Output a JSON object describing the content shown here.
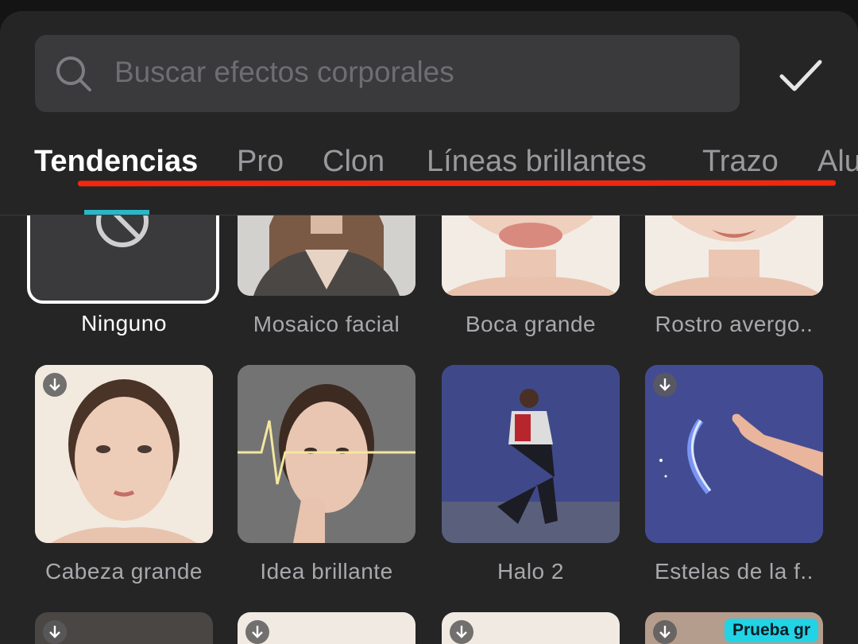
{
  "search": {
    "placeholder": "Buscar efectos corporales"
  },
  "tabs": [
    {
      "label": "Tendencias",
      "active": true
    },
    {
      "label": "Pro"
    },
    {
      "label": "Clon"
    },
    {
      "label": "Líneas brillantes"
    },
    {
      "label": "Trazo"
    },
    {
      "label": "Alu"
    }
  ],
  "effects_row1": [
    {
      "label": "Ninguno",
      "selected": true
    },
    {
      "label": "Mosaico facial"
    },
    {
      "label": "Boca grande"
    },
    {
      "label": "Rostro avergo.."
    }
  ],
  "effects_row2": [
    {
      "label": "Cabeza grande"
    },
    {
      "label": "Idea brillante"
    },
    {
      "label": "Halo 2"
    },
    {
      "label": "Estelas de la f.."
    }
  ],
  "effects_row3": [
    {
      "label": ""
    },
    {
      "label": ""
    },
    {
      "label": ""
    },
    {
      "label": "",
      "badge": "Prueba gr"
    }
  ],
  "colors": {
    "accent_underline": "#f0280f",
    "selected_indicator": "#2bb6c8",
    "promo_badge": "#22d3e6"
  },
  "icons": [
    "search-icon",
    "checkmark-icon",
    "none-icon",
    "download-icon"
  ]
}
